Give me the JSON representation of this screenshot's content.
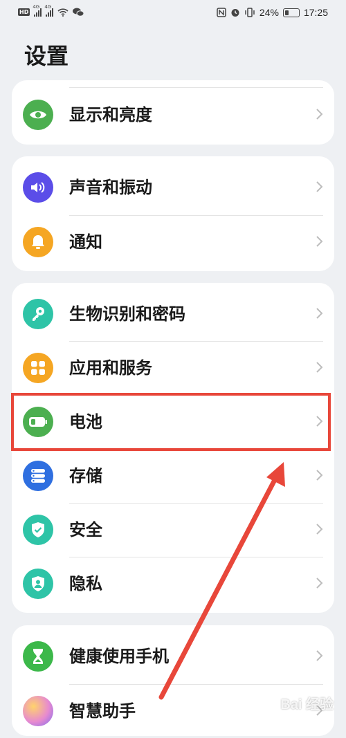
{
  "status_bar": {
    "hd_label": "HD",
    "sim1": "1",
    "net1": "4G",
    "net2": "4G",
    "battery_percent": "24%",
    "time": "17:25"
  },
  "page_title": "设置",
  "groups": [
    {
      "items": [
        {
          "label": "显示和亮度",
          "icon": "eye-icon",
          "color": "#4caf50"
        }
      ]
    },
    {
      "items": [
        {
          "label": "声音和振动",
          "icon": "speaker-icon",
          "color": "#5b4de8"
        },
        {
          "label": "通知",
          "icon": "bell-icon",
          "color": "#f5a623"
        }
      ]
    },
    {
      "items": [
        {
          "label": "生物识别和密码",
          "icon": "key-icon",
          "color": "#2ec4a7"
        },
        {
          "label": "应用和服务",
          "icon": "apps-grid-icon",
          "color": "#f5a623"
        },
        {
          "label": "电池",
          "icon": "battery-icon",
          "color": "#4caf50"
        },
        {
          "label": "存储",
          "icon": "storage-icon",
          "color": "#2f6fe0"
        },
        {
          "label": "安全",
          "icon": "shield-check-icon",
          "color": "#2ec4a7"
        },
        {
          "label": "隐私",
          "icon": "privacy-shield-icon",
          "color": "#2ec4a7"
        }
      ]
    },
    {
      "items": [
        {
          "label": "健康使用手机",
          "icon": "hourglass-icon",
          "color": "#3cb84a"
        },
        {
          "label": "智慧助手",
          "icon": "assistant-orb-icon",
          "color": "#e78ad0"
        }
      ]
    }
  ],
  "annotation": {
    "highlight_color": "#e8473a",
    "highlighted_item": "电池"
  },
  "watermark": "Bai 经验"
}
